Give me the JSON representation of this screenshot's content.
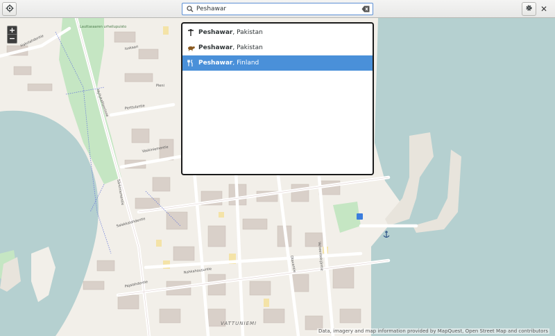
{
  "header": {
    "search_value": "Peshawar"
  },
  "results": [
    {
      "name": "Peshawar",
      "place": ", Pakistan",
      "icon": "landmark-icon",
      "selected": false
    },
    {
      "name": "Peshawar",
      "place": ", Pakistan",
      "icon": "animal-icon",
      "selected": false
    },
    {
      "name": "Peshawar",
      "place": ", Finland",
      "icon": "restaurant-icon",
      "selected": true
    }
  ],
  "map": {
    "zoom_in": "+",
    "zoom_out": "−",
    "streets": [
      "Hakolahdentie",
      "Lauttasaaren urheilupuisto",
      "Isokaari",
      "Pieni",
      "Perttulantie",
      "Myllykallionrinne",
      "Vaskiniementie",
      "Salakkalahdentie",
      "Särkiniementie",
      "Nahkahousuntie",
      "Pajalahdentie",
      "Otavantie",
      "Veneentekijäntie"
    ],
    "district": "VATTUNIEMI",
    "parking_label": "P",
    "attribution": "Data, imagery and map information provided by MapQuest, Open Street Map and contributors"
  },
  "colors": {
    "water": "#b5d0d0",
    "land": "#f2efe9",
    "park": "#c5e6c3",
    "building": "#d9d0c9",
    "selection": "#4a90d9"
  }
}
